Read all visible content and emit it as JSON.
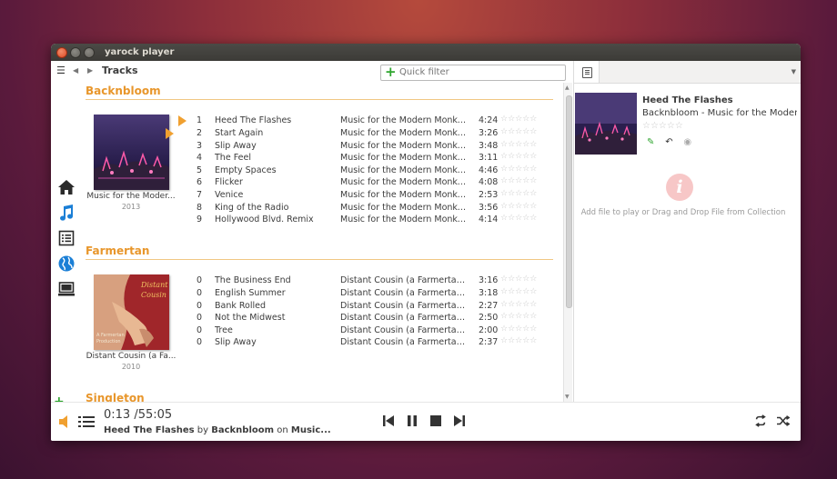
{
  "window": {
    "title": "yarock player"
  },
  "toolbar": {
    "view_title": "Tracks",
    "filter_placeholder": "Quick filter"
  },
  "colors": {
    "accent": "#e8962b",
    "add": "#2ea52e",
    "info": "#f7c7c7"
  },
  "sidebar": {
    "items": [
      {
        "icon": "home-icon"
      },
      {
        "icon": "music-note-icon"
      },
      {
        "icon": "playlist-icon"
      },
      {
        "icon": "globe-icon"
      },
      {
        "icon": "computer-icon"
      }
    ]
  },
  "albums": [
    {
      "artist": "Backnbloom",
      "album": "Music for the Moder...",
      "year": "2013",
      "tracks": [
        {
          "num": "1",
          "title": "Heed The Flashes",
          "album": "Music for the Modern Monkey",
          "dur": "4:24",
          "rating": "☆☆☆☆☆"
        },
        {
          "num": "2",
          "title": "Start Again",
          "album": "Music for the Modern Monkey",
          "dur": "3:26",
          "rating": "☆☆☆☆☆"
        },
        {
          "num": "3",
          "title": "Slip Away",
          "album": "Music for the Modern Monkey",
          "dur": "3:48",
          "rating": "☆☆☆☆☆"
        },
        {
          "num": "4",
          "title": "The Feel",
          "album": "Music for the Modern Monkey",
          "dur": "3:11",
          "rating": "☆☆☆☆☆"
        },
        {
          "num": "5",
          "title": "Empty Spaces",
          "album": "Music for the Modern Monkey",
          "dur": "4:46",
          "rating": "☆☆☆☆☆"
        },
        {
          "num": "6",
          "title": "Flicker",
          "album": "Music for the Modern Monkey",
          "dur": "4:08",
          "rating": "☆☆☆☆☆"
        },
        {
          "num": "7",
          "title": "Venice",
          "album": "Music for the Modern Monkey",
          "dur": "2:53",
          "rating": "☆☆☆☆☆"
        },
        {
          "num": "8",
          "title": "King of the Radio",
          "album": "Music for the Modern Monkey",
          "dur": "3:56",
          "rating": "☆☆☆☆☆"
        },
        {
          "num": "9",
          "title": "Hollywood Blvd. Remix",
          "album": "Music for the Modern Monkey",
          "dur": "4:14",
          "rating": "☆☆☆☆☆"
        }
      ]
    },
    {
      "artist": "Farmertan",
      "album": "Distant Cousin (a Fa...",
      "year": "2010",
      "tracks": [
        {
          "num": "0",
          "title": "The Business End",
          "album": "Distant Cousin (a Farmertan ...",
          "dur": "3:16",
          "rating": "☆☆☆☆☆"
        },
        {
          "num": "0",
          "title": "English Summer",
          "album": "Distant Cousin (a Farmertan ...",
          "dur": "3:18",
          "rating": "☆☆☆☆☆"
        },
        {
          "num": "0",
          "title": "Bank Rolled",
          "album": "Distant Cousin (a Farmertan ...",
          "dur": "2:27",
          "rating": "☆☆☆☆☆"
        },
        {
          "num": "0",
          "title": "Not the Midwest",
          "album": "Distant Cousin (a Farmertan ...",
          "dur": "2:50",
          "rating": "☆☆☆☆☆"
        },
        {
          "num": "0",
          "title": "Tree",
          "album": "Distant Cousin (a Farmertan ...",
          "dur": "2:00",
          "rating": "☆☆☆☆☆"
        },
        {
          "num": "0",
          "title": "Slip Away",
          "album": "Distant Cousin (a Farmertan ...",
          "dur": "2:37",
          "rating": "☆☆☆☆☆"
        }
      ]
    },
    {
      "artist": "Singleton"
    }
  ],
  "now_playing": {
    "title": "Heed The Flashes",
    "subtitle": "Backnbloom - Music for the Moder...",
    "rating": "☆☆☆☆☆",
    "info_message": "Add file to play or Drag and Drop File from Collection"
  },
  "player": {
    "time": "0:13 /55:05",
    "track": "Heed The Flashes",
    "by": "by",
    "artist": "Backnbloom",
    "on": "on",
    "album": "Music..."
  }
}
